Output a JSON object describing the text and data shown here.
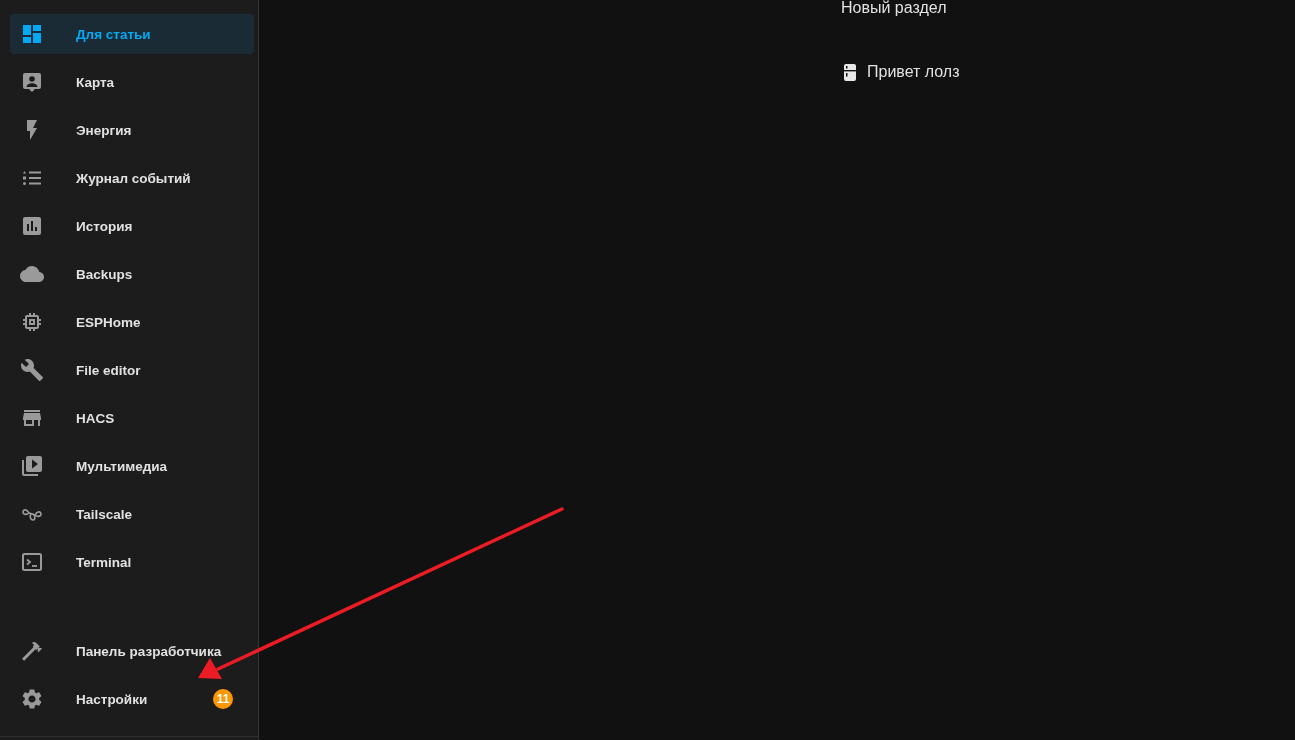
{
  "sidebar": {
    "items": [
      {
        "label": "Для статьи",
        "selected": true
      },
      {
        "label": "Карта",
        "selected": false
      },
      {
        "label": "Энергия",
        "selected": false
      },
      {
        "label": "Журнал событий",
        "selected": false
      },
      {
        "label": "История",
        "selected": false
      },
      {
        "label": "Backups",
        "selected": false
      },
      {
        "label": "ESPHome",
        "selected": false
      },
      {
        "label": "File editor",
        "selected": false
      },
      {
        "label": "HACS",
        "selected": false
      },
      {
        "label": "Мультимедиа",
        "selected": false
      },
      {
        "label": "Tailscale",
        "selected": false
      },
      {
        "label": "Terminal",
        "selected": false
      }
    ],
    "footer_items": [
      {
        "label": "Панель разработчика",
        "selected": false
      },
      {
        "label": "Настройки",
        "selected": false,
        "badge": "11"
      }
    ]
  },
  "main": {
    "section_title": "Новый раздел",
    "entities": [
      {
        "name": "Привет лолз"
      }
    ]
  }
}
